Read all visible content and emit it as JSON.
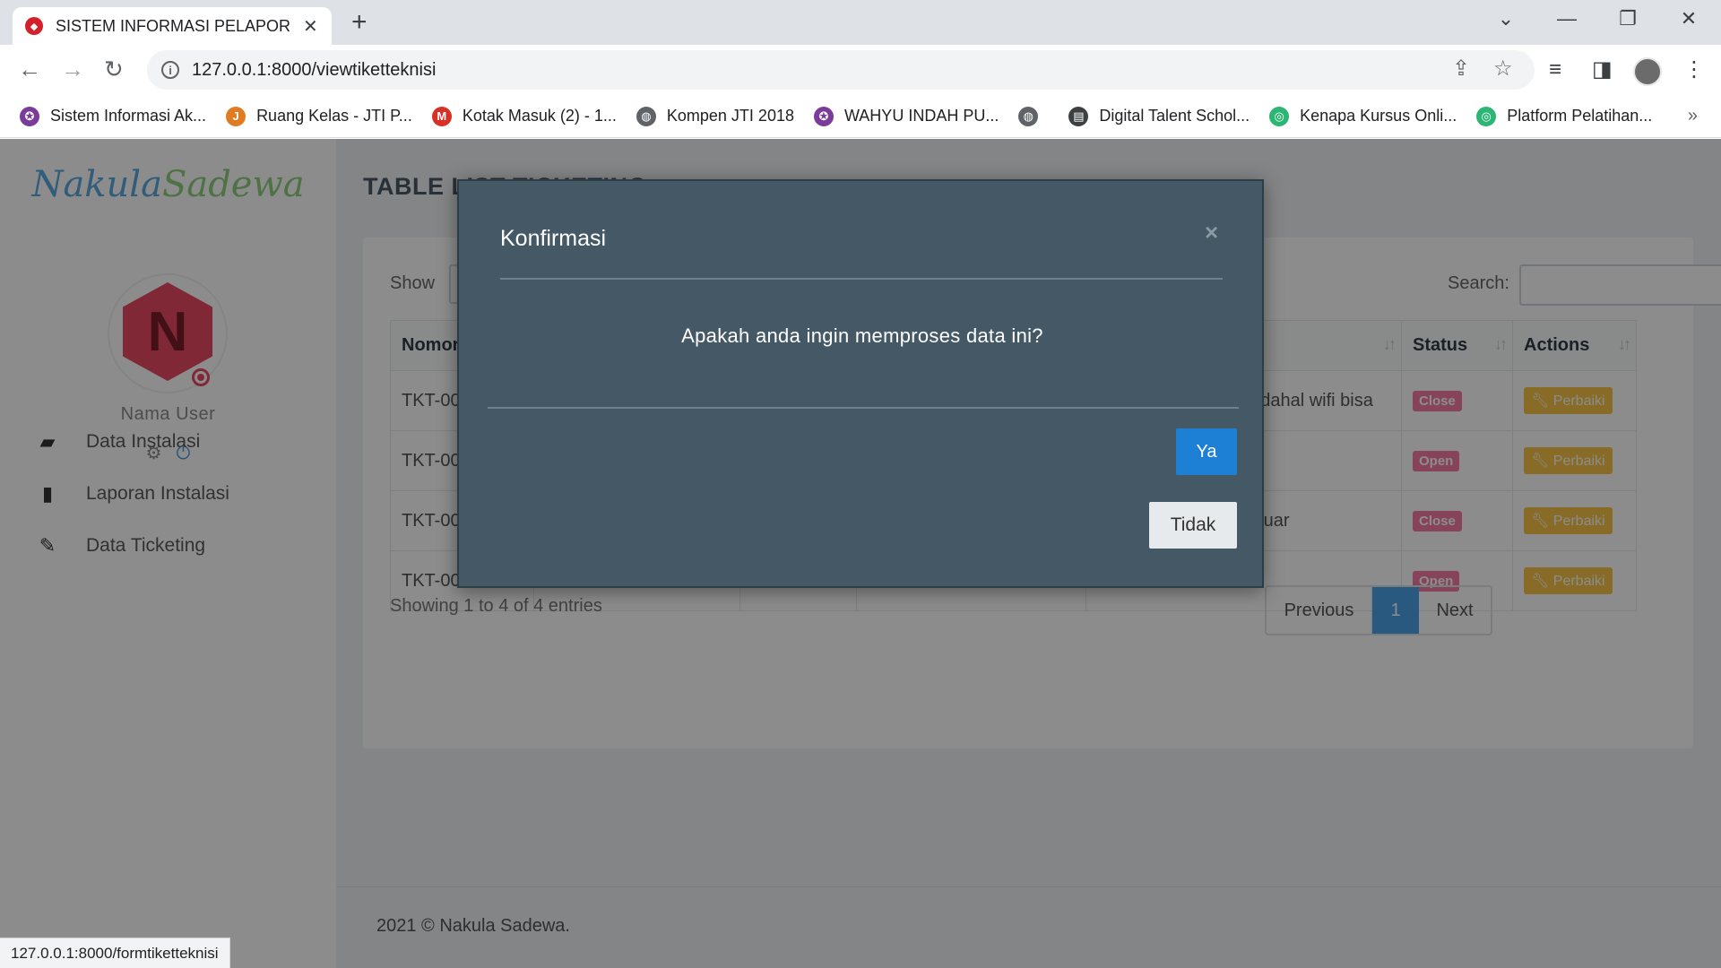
{
  "browser": {
    "tab_title": "SISTEM INFORMASI PELAPORAN",
    "url": "127.0.0.1:8000/viewtiketteknisi",
    "status_url": "127.0.0.1:8000/formtiketteknisi",
    "bookmarks": [
      {
        "label": "Sistem Informasi Ak...",
        "icon": "university-seal-icon",
        "color": "#7b3b9a"
      },
      {
        "label": "Ruang Kelas - JTI P...",
        "icon": "ruang-kelas-icon",
        "color": "#e07b22"
      },
      {
        "label": "Kotak Masuk (2) - 1...",
        "icon": "gmail-icon",
        "color": "#d93025"
      },
      {
        "label": "Kompen JTI 2018",
        "icon": "globe-icon",
        "color": "#5f6368"
      },
      {
        "label": "WAHYU INDAH PU...",
        "icon": "university-seal-icon",
        "color": "#7b3b9a"
      },
      {
        "label": "",
        "icon": "globe-icon",
        "color": "#5f6368"
      },
      {
        "label": "Digital Talent Schol...",
        "icon": "book-icon",
        "color": "#3c4043"
      },
      {
        "label": "Kenapa Kursus Onli...",
        "icon": "course-icon",
        "color": "#2bb673"
      },
      {
        "label": "Platform Pelatihan...",
        "icon": "course-icon",
        "color": "#2bb673"
      }
    ]
  },
  "sidebar": {
    "brand_part1": "Nakula",
    "brand_part2": "Sadewa",
    "avatar_letter": "N",
    "user_name": "Nama User",
    "menu": [
      {
        "label": "Data Instalasi",
        "icon": "book-icon"
      },
      {
        "label": "Laporan Instalasi",
        "icon": "file-icon"
      },
      {
        "label": "Data Ticketing",
        "icon": "ticket-icon"
      }
    ]
  },
  "main": {
    "page_title": "TABLE LIST TICKETING",
    "show_label": "Show",
    "search_label": "Search:",
    "table": {
      "headers": [
        "Nomor",
        "",
        "",
        "",
        "",
        "Status",
        "Actions"
      ],
      "rows": [
        {
          "nomor": "TKT-00",
          "keterangan": "padahal wifi bisa",
          "status": "Close",
          "action": "Perbaiki"
        },
        {
          "nomor": "TKT-00",
          "keterangan": "",
          "status": "Open",
          "action": "Perbaiki"
        },
        {
          "nomor": "TKT-00",
          "keterangan": "keluar",
          "status": "Close",
          "action": "Perbaiki"
        },
        {
          "nomor": "TKT-00",
          "keterangan": "",
          "status": "Open",
          "action": "Perbaiki"
        }
      ]
    },
    "entries_info": "Showing 1 to 4 of 4 entries",
    "pagination": {
      "previous": "Previous",
      "current": "1",
      "next": "Next"
    },
    "footer": "2021 © Nakula Sadewa."
  },
  "modal": {
    "title": "Konfirmasi",
    "close_glyph": "×",
    "message": "Apakah anda ingin memproses data ini?",
    "confirm_label": "Ya",
    "cancel_label": "Tidak"
  },
  "colors": {
    "modal_bg": "#445866",
    "primary_button": "#1e80d4",
    "badge_pink": "#f47aa4",
    "action_yellow": "#f6c445",
    "pager_active": "#4da3e8"
  }
}
